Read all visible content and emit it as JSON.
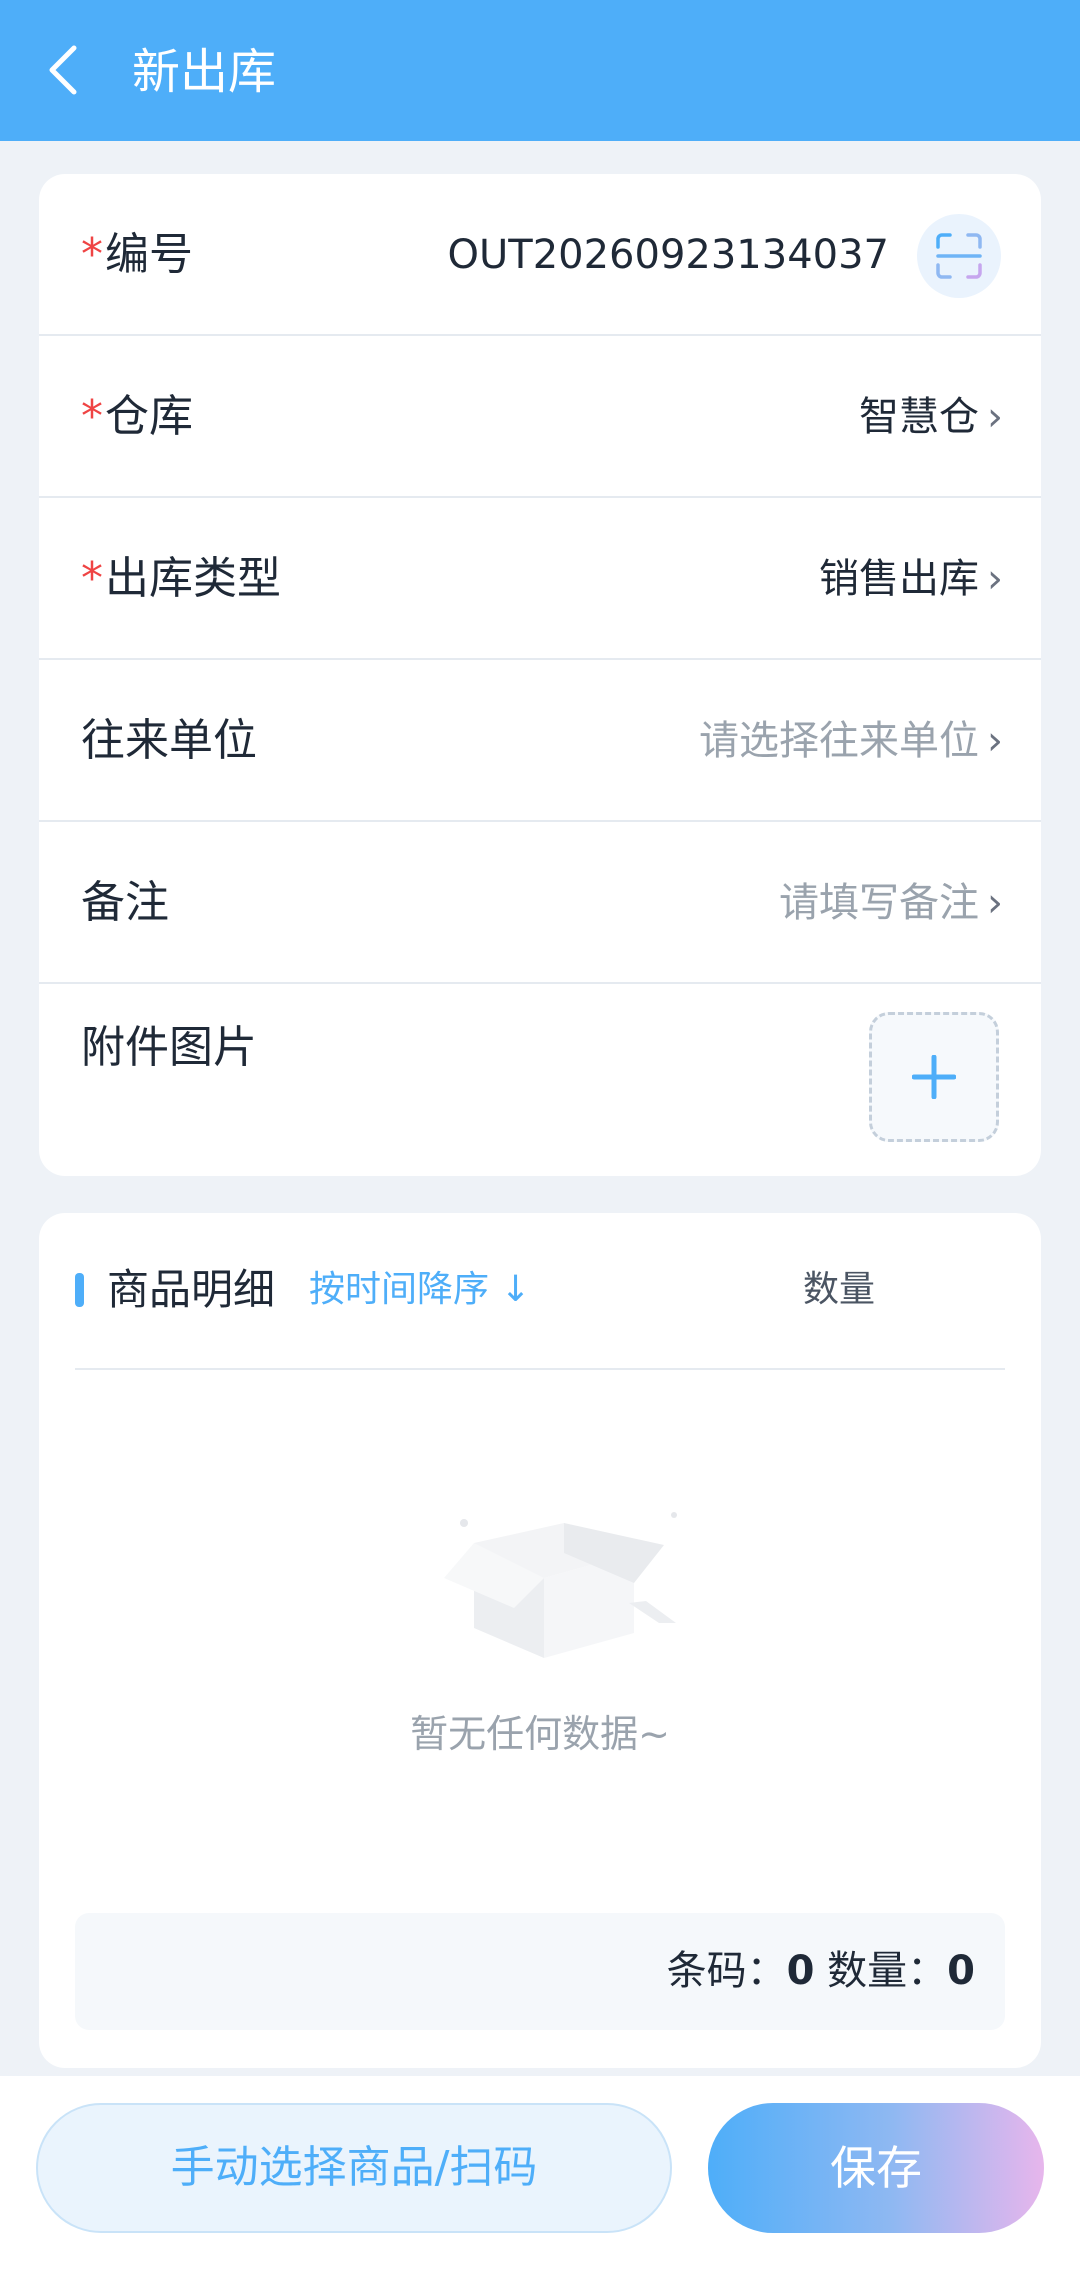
{
  "header": {
    "title": "新出库"
  },
  "form": {
    "required_mark": "*",
    "chevron": "›",
    "code": {
      "label": "编号",
      "value": "OUT20260923134037"
    },
    "warehouse": {
      "label": "仓库",
      "value": "智慧仓"
    },
    "outbound_type": {
      "label": "出库类型",
      "value": "销售出库"
    },
    "partner": {
      "label": "往来单位",
      "placeholder": "请选择往来单位"
    },
    "remark": {
      "label": "备注",
      "placeholder": "请填写备注"
    },
    "attachment": {
      "label": "附件图片"
    }
  },
  "details": {
    "title": "商品明细",
    "sort_label": "按时间降序 ↓",
    "qty_header": "数量",
    "empty_text": "暂无任何数据~",
    "summary": {
      "barcode_label": "条码：",
      "barcode_count": "0",
      "qty_label": "数量：",
      "qty_count": "0"
    }
  },
  "footer": {
    "manual_select_label": "手动选择商品/扫码",
    "save_label": "保存"
  },
  "colors": {
    "primary": "#4eaef9",
    "required": "#ef4444",
    "placeholder": "#9aa3ad"
  },
  "icons": [
    "back-icon",
    "scan-icon",
    "chevron-right-icon",
    "plus-icon",
    "empty-box-icon"
  ]
}
